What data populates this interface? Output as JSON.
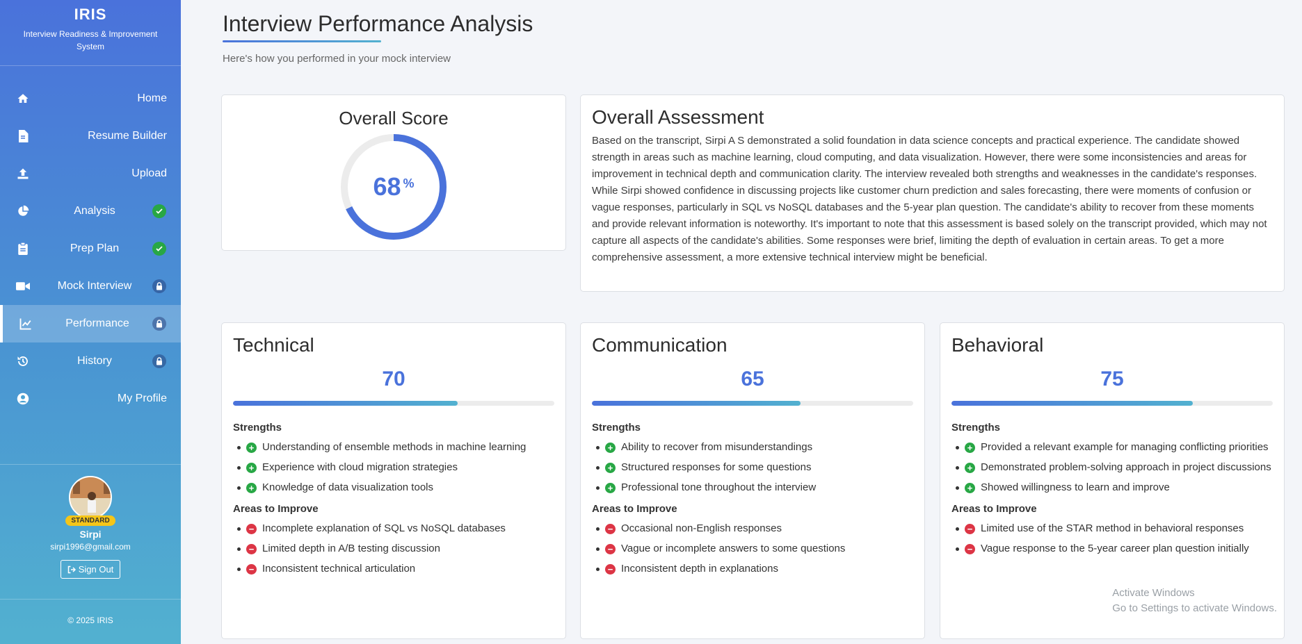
{
  "sidebar": {
    "brand": "IRIS",
    "subtitle": "Interview Readiness & Improvement System",
    "items": [
      {
        "label": "Home",
        "icon": "home-icon",
        "status": "none"
      },
      {
        "label": "Resume Builder",
        "icon": "file-icon",
        "status": "none"
      },
      {
        "label": "Upload",
        "icon": "upload-icon",
        "status": "none"
      },
      {
        "label": "Analysis",
        "icon": "pie-chart-icon",
        "status": "complete"
      },
      {
        "label": "Prep Plan",
        "icon": "clipboard-icon",
        "status": "complete"
      },
      {
        "label": "Mock Interview",
        "icon": "video-icon",
        "status": "locked"
      },
      {
        "label": "Performance",
        "icon": "chart-line-icon",
        "status": "locked",
        "active": true
      },
      {
        "label": "History",
        "icon": "history-icon",
        "status": "locked"
      },
      {
        "label": "My Profile",
        "icon": "user-circle-icon",
        "status": "none"
      }
    ],
    "profile": {
      "tier": "STANDARD",
      "name": "Sirpi",
      "email": "sirpi1996@gmail.com",
      "signout": "Sign Out"
    },
    "copyright": "© 2025 IRIS"
  },
  "main": {
    "title": "Interview Performance Analysis",
    "subtitle": "Here's how you performed in your mock interview",
    "overall_score": {
      "title": "Overall Score",
      "value": "68",
      "unit": "%",
      "fraction": 0.68
    },
    "assessment": {
      "title": "Overall Assessment",
      "text": "Based on the transcript, Sirpi A S demonstrated a solid foundation in data science concepts and practical experience. The candidate showed strength in areas such as machine learning, cloud computing, and data visualization. However, there were some inconsistencies and areas for improvement in technical depth and communication clarity. The interview revealed both strengths and weaknesses in the candidate's responses. While Sirpi showed confidence in discussing projects like customer churn prediction and sales forecasting, there were moments of confusion or vague responses, particularly in SQL vs NoSQL databases and the 5-year plan question. The candidate's ability to recover from these moments and provide relevant information is noteworthy. It's important to note that this assessment is based solely on the transcript provided, which may not capture all aspects of the candidate's abilities. Some responses were brief, limiting the depth of evaluation in certain areas. To get a more comprehensive assessment, a more extensive technical interview might be beneficial."
    },
    "categories": [
      {
        "title": "Technical",
        "score": "70",
        "fraction": 0.7,
        "strengths_label": "Strengths",
        "strengths": [
          "Understanding of ensemble methods in machine learning",
          "Experience with cloud migration strategies",
          "Knowledge of data visualization tools"
        ],
        "improve_label": "Areas to Improve",
        "improve": [
          "Incomplete explanation of SQL vs NoSQL databases",
          "Limited depth in A/B testing discussion",
          "Inconsistent technical articulation"
        ]
      },
      {
        "title": "Communication",
        "score": "65",
        "fraction": 0.65,
        "strengths_label": "Strengths",
        "strengths": [
          "Ability to recover from misunderstandings",
          "Structured responses for some questions",
          "Professional tone throughout the interview"
        ],
        "improve_label": "Areas to Improve",
        "improve": [
          "Occasional non-English responses",
          "Vague or incomplete answers to some questions",
          "Inconsistent depth in explanations"
        ]
      },
      {
        "title": "Behavioral",
        "score": "75",
        "fraction": 0.75,
        "strengths_label": "Strengths",
        "strengths": [
          "Provided a relevant example for managing conflicting priorities",
          "Demonstrated problem-solving approach in project discussions",
          "Showed willingness to learn and improve"
        ],
        "improve_label": "Areas to Improve",
        "improve": [
          "Limited use of the STAR method in behavioral responses",
          "Vague response to the 5-year career plan question initially"
        ]
      }
    ]
  },
  "watermark": {
    "line1": "Activate Windows",
    "line2": "Go to Settings to activate Windows."
  },
  "colors": {
    "accent": "#4a72db",
    "accent2": "#52b1d0",
    "success": "#28a745",
    "danger": "#dc3545",
    "tier": "#f5c518"
  }
}
